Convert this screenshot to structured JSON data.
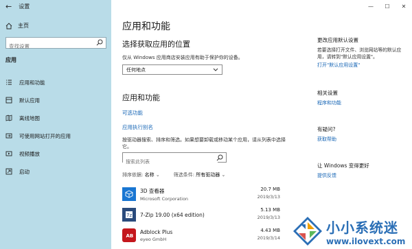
{
  "window": {
    "title": "设置",
    "back_icon": "arrow-left-icon"
  },
  "sidebar": {
    "home": "主页",
    "search_placeholder": "查找设置",
    "section": "应用",
    "items": [
      {
        "label": "应用和功能"
      },
      {
        "label": "默认应用"
      },
      {
        "label": "离线地图"
      },
      {
        "label": "可使用网站打开的应用"
      },
      {
        "label": "视频播放"
      },
      {
        "label": "启动"
      }
    ]
  },
  "main": {
    "title": "应用和功能",
    "choose_title": "选择获取应用的位置",
    "choose_desc": "仅从 Windows 应用商店安装应用有助于保护你的设备。",
    "dropdown_value": "任何地点",
    "apps_title": "应用和功能",
    "link_optional": "可选功能",
    "link_alias": "应用执行别名",
    "search_desc": "按驱动器搜索、排序和筛选。如果想要卸载或移动某个应用，请从列表中选择它。",
    "search_placeholder": "搜索此列表",
    "sort_label": "排序依据:",
    "sort_value": "名称",
    "filter_label": "筛选条件:",
    "filter_value": "所有驱动器",
    "apps": [
      {
        "name": "3D 查看器",
        "publisher": "Microsoft Corporation",
        "size": "20.7 MB",
        "date": "2019/3/13",
        "icon": "cube-3d-icon",
        "color": "#1976d2"
      },
      {
        "name": "7-Zip 19.00 (x64 edition)",
        "publisher": "",
        "size": "5.13 MB",
        "date": "2019/3/13",
        "icon": "7zip-icon",
        "color": "#2a4b7c"
      },
      {
        "name": "Adblock Plus",
        "publisher": "eyeo GmbH",
        "size": "4.43 MB",
        "date": "2019/3/14",
        "icon": "adblock-icon",
        "color": "#c4161c"
      }
    ]
  },
  "right": {
    "default_title": "更改应用默认设置",
    "default_desc": "若要选择打开文件、浏览网站等的默认应用，请转到\"默认应用设置\"。",
    "default_link": "打开\"默认应用设置\"",
    "related_title": "相关设置",
    "related_link": "程序和功能",
    "question_title": "有疑问?",
    "question_link": "获取帮助",
    "better_title": "让 Windows 变得更好",
    "better_link": "提供反馈"
  },
  "watermark": {
    "text": "小小系统迷",
    "url": "www.ilovext.com"
  }
}
